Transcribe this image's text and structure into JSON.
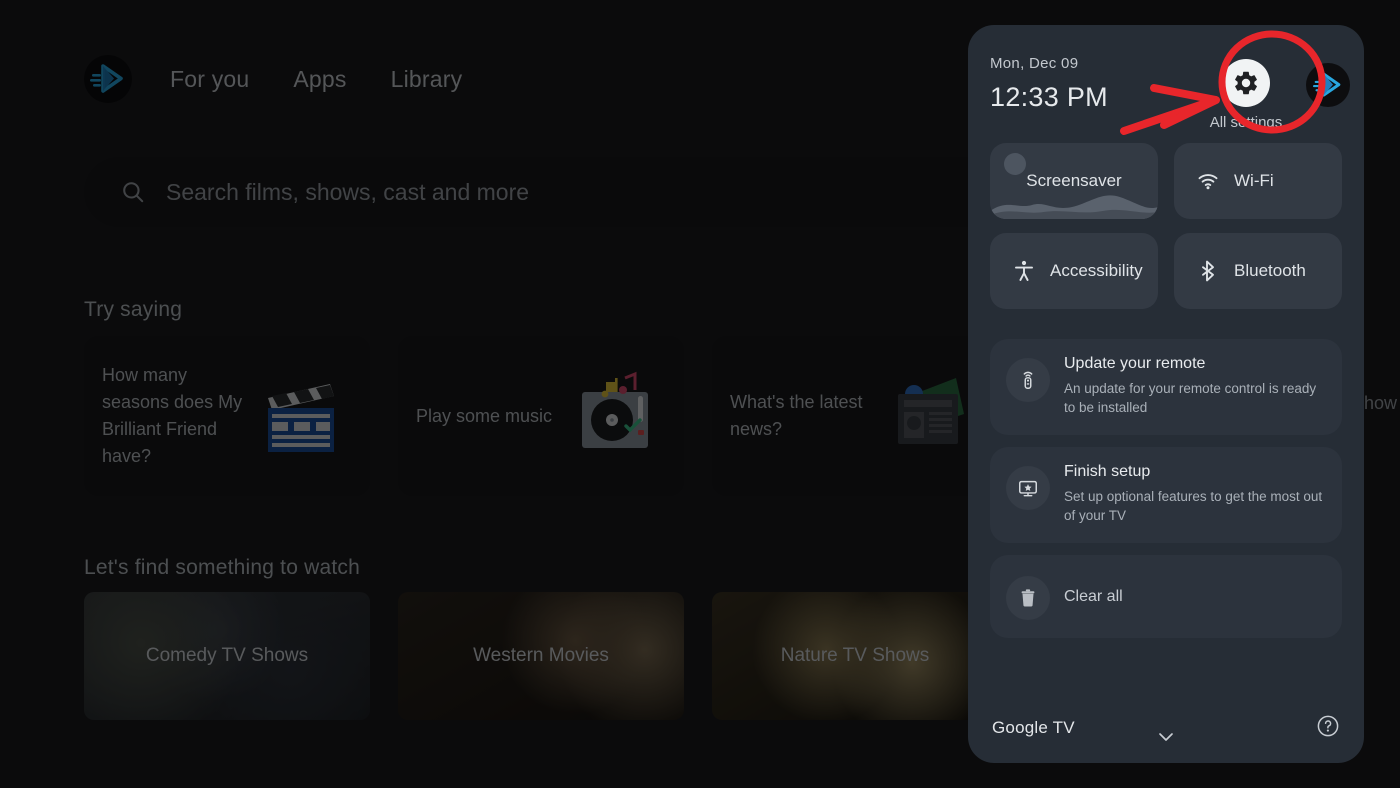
{
  "home": {
    "nav": {
      "logo_icon": "google-tv-play-logo",
      "tabs": [
        {
          "label": "For you"
        },
        {
          "label": "Apps"
        },
        {
          "label": "Library"
        }
      ]
    },
    "search": {
      "icon": "search-icon",
      "placeholder": "Search films, shows, cast and more"
    },
    "try_saying": {
      "title": "Try saying",
      "cards": [
        {
          "text": "How many seasons does My Brilliant Friend have?",
          "art": "clapperboard-icon"
        },
        {
          "text": "Play some music",
          "art": "turntable-icon"
        },
        {
          "text": "What's the latest news?",
          "art": "newspaper-icon"
        }
      ]
    },
    "find_watch": {
      "title": "Let's find something to watch",
      "cards": [
        {
          "label": "Comedy TV Shows"
        },
        {
          "label": "Western Movies"
        },
        {
          "label": "Nature TV Shows"
        }
      ]
    },
    "clipped_text": "Show free"
  },
  "panel": {
    "date": "Mon, Dec 09",
    "time": "12:33 PM",
    "all_settings": {
      "label": "All settings",
      "icon": "gear-icon"
    },
    "avatar_icon": "profile-avatar",
    "tiles": [
      {
        "label": "Screensaver",
        "icon": "screensaver-illustration"
      },
      {
        "label": "Wi-Fi",
        "icon": "wifi-icon"
      },
      {
        "label": "Accessibility",
        "icon": "accessibility-icon"
      },
      {
        "label": "Bluetooth",
        "icon": "bluetooth-icon"
      }
    ],
    "notifications": [
      {
        "title": "Update your remote",
        "subtitle": "An update for your remote control is ready to be installed",
        "icon": "remote-control-icon"
      },
      {
        "title": "Finish setup",
        "subtitle": "Set up optional features to get the most out of your TV",
        "icon": "tv-star-icon"
      }
    ],
    "clear_all": {
      "label": "Clear all",
      "icon": "trash-icon"
    },
    "footer": {
      "brand": "Google TV",
      "help_icon": "help-circle-icon",
      "collapse_icon": "chevron-down-icon"
    }
  },
  "annotation": {
    "highlight_color": "#e8262b",
    "shapes": [
      "circle-highlight",
      "arrow-pointer"
    ]
  }
}
